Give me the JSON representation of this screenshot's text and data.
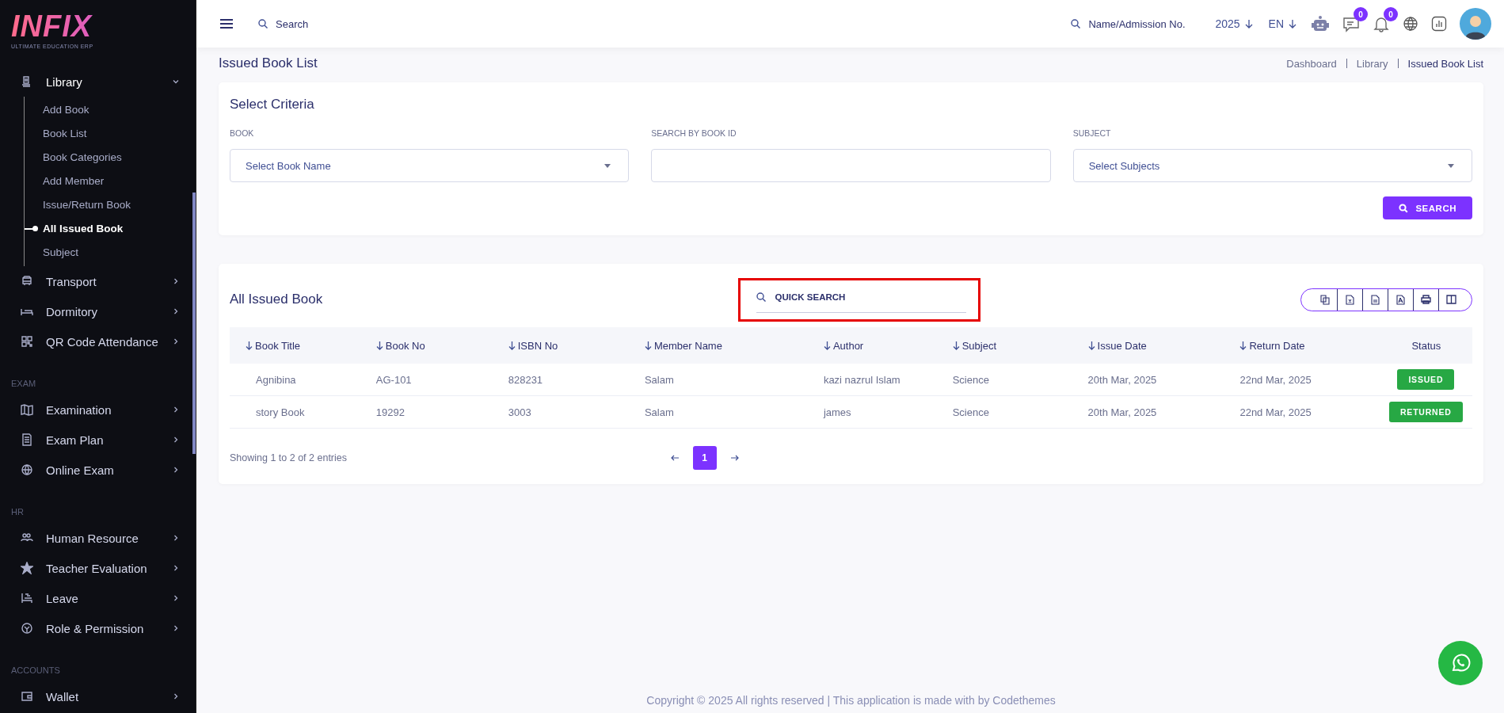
{
  "sidebar": {
    "logo": {
      "title": "INFIX",
      "subtitle": "ULTIMATE EDUCATION ERP"
    },
    "sections": [
      {
        "items": [
          {
            "label": "Library",
            "expanded": true,
            "children": [
              {
                "label": "Add Book",
                "selected": false
              },
              {
                "label": "Book List",
                "selected": false
              },
              {
                "label": "Book Categories",
                "selected": false
              },
              {
                "label": "Add Member",
                "selected": false
              },
              {
                "label": "Issue/Return Book",
                "selected": false
              },
              {
                "label": "All Issued Book",
                "selected": true
              },
              {
                "label": "Subject",
                "selected": false
              }
            ]
          },
          {
            "label": "Transport",
            "expanded": false
          },
          {
            "label": "Dormitory",
            "expanded": false
          },
          {
            "label": "QR Code Attendance",
            "expanded": false
          }
        ]
      },
      {
        "label": "EXAM",
        "items": [
          {
            "label": "Examination",
            "expanded": false
          },
          {
            "label": "Exam Plan",
            "expanded": false
          },
          {
            "label": "Online Exam",
            "expanded": false
          }
        ]
      },
      {
        "label": "HR",
        "items": [
          {
            "label": "Human Resource",
            "expanded": false
          },
          {
            "label": "Teacher Evaluation",
            "expanded": false
          },
          {
            "label": "Leave",
            "expanded": false
          },
          {
            "label": "Role & Permission",
            "expanded": false
          }
        ]
      },
      {
        "label": "ACCOUNTS",
        "items": [
          {
            "label": "Wallet",
            "expanded": false
          }
        ]
      }
    ]
  },
  "header": {
    "search": {
      "placeholder": "Search"
    },
    "student_search": {
      "placeholder": "Name/Admission No."
    },
    "year": "2025",
    "language": "EN",
    "messages_count": "0",
    "notifications_count": "0"
  },
  "page": {
    "title": "Issued Book List",
    "breadcrumbs": [
      "Dashboard",
      "Library",
      "Issued Book List"
    ]
  },
  "criteria": {
    "title": "Select Criteria",
    "fields": [
      {
        "kind": "select",
        "label": "BOOK",
        "placeholder": "Select Book Name"
      },
      {
        "kind": "text",
        "label": "SEARCH BY BOOK ID"
      },
      {
        "kind": "select",
        "label": "SUBJECT",
        "placeholder": "Select Subjects"
      }
    ],
    "button": "SEARCH"
  },
  "table": {
    "title": "All Issued Book",
    "quick_search": {
      "placeholder": "QUICK SEARCH",
      "highlighted": true
    },
    "columns": [
      {
        "label": "Book Title",
        "sortable": true
      },
      {
        "label": "Book No",
        "sortable": true
      },
      {
        "label": "ISBN No",
        "sortable": true
      },
      {
        "label": "Member Name",
        "sortable": true
      },
      {
        "label": "Author",
        "sortable": true
      },
      {
        "label": "Subject",
        "sortable": true
      },
      {
        "label": "Issue Date",
        "sortable": true
      },
      {
        "label": "Return Date",
        "sortable": true
      },
      {
        "label": "Status",
        "sortable": false
      }
    ],
    "rows": [
      {
        "cells": [
          "Agnibina",
          "AG-101",
          "828231",
          "Salam",
          "kazi nazrul Islam",
          "Science",
          "20th Mar, 2025",
          "22nd Mar, 2025"
        ],
        "status": "ISSUED"
      },
      {
        "cells": [
          "story Book",
          "19292",
          "3003",
          "Salam",
          "james",
          "Science",
          "20th Mar, 2025",
          "22nd Mar, 2025"
        ],
        "status": "RETURNED"
      }
    ],
    "summary": "Showing 1 to 2 of 2 entries",
    "pages": [
      {
        "label": "1",
        "selected": true
      }
    ]
  },
  "footer": "Copyright © 2025 All rights reserved | This application is made with by Codethemes"
}
